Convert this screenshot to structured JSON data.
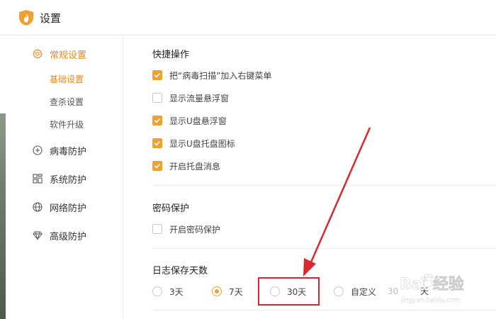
{
  "window": {
    "title": "设置"
  },
  "sidebar": {
    "groups": [
      {
        "label": "常规设置",
        "icon": "gear-icon",
        "active": true,
        "items": [
          {
            "label": "基础设置",
            "active": true
          },
          {
            "label": "查杀设置",
            "active": false
          },
          {
            "label": "软件升级",
            "active": false
          }
        ]
      },
      {
        "label": "病毒防护",
        "icon": "plus-square-icon",
        "active": false
      },
      {
        "label": "系统防护",
        "icon": "grid-icon",
        "active": false
      },
      {
        "label": "网络防护",
        "icon": "globe-icon",
        "active": false
      },
      {
        "label": "高级防护",
        "icon": "diamond-icon",
        "active": false
      }
    ]
  },
  "quick_ops": {
    "title": "快捷操作",
    "options": [
      {
        "label": "把“病毒扫描”加入右键菜单",
        "checked": true
      },
      {
        "label": "显示流量悬浮窗",
        "checked": false
      },
      {
        "label": "显示U盘悬浮窗",
        "checked": true
      },
      {
        "label": "显示U盘托盘图标",
        "checked": true
      },
      {
        "label": "开启托盘消息",
        "checked": true
      }
    ]
  },
  "password": {
    "title": "密码保护",
    "options": [
      {
        "label": "开启密码保护",
        "checked": false
      }
    ]
  },
  "log_days": {
    "title": "日志保存天数",
    "options": [
      {
        "label": "3天",
        "selected": false
      },
      {
        "label": "7天",
        "selected": true
      },
      {
        "label": "30天",
        "selected": false
      },
      {
        "label": "自定义",
        "selected": false
      }
    ],
    "custom_value": "30",
    "custom_unit": "天"
  },
  "colors": {
    "accent": "#f0a030",
    "annotation": "#d9282f"
  },
  "watermark": {
    "text": "Bai 经验",
    "sub": "jingyan.baidu.com"
  }
}
